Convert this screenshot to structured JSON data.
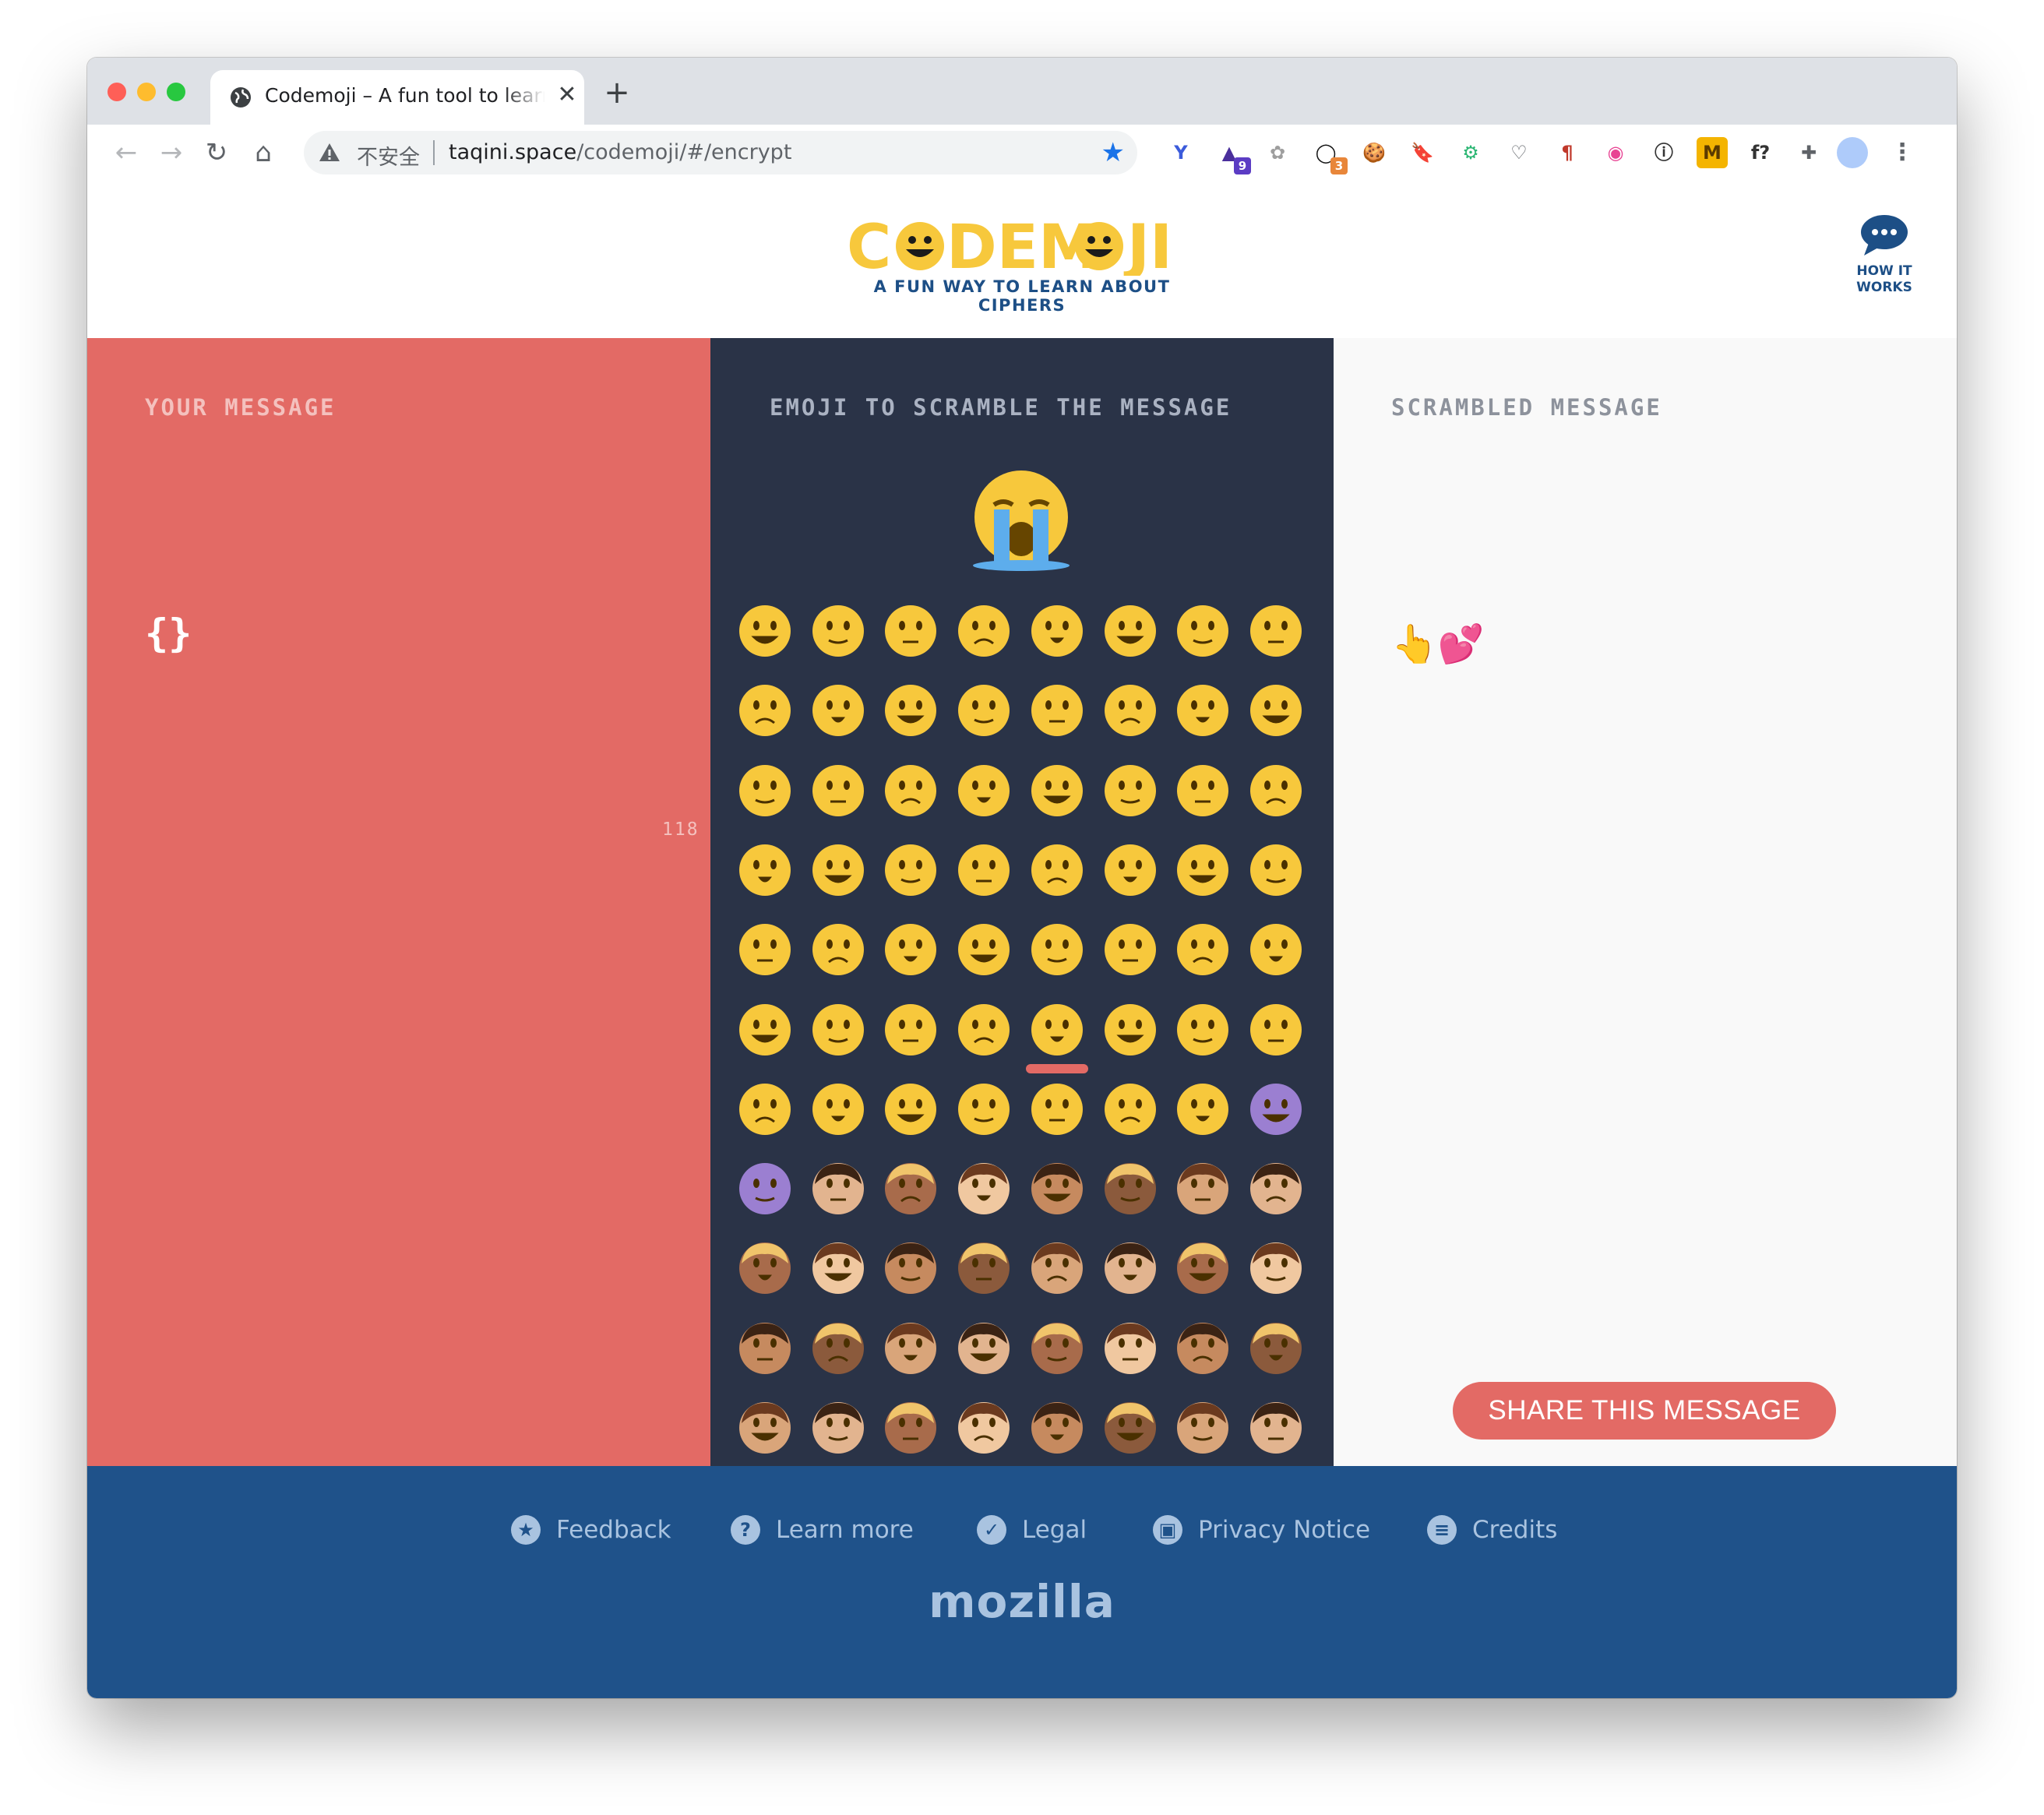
{
  "browser": {
    "tab_title": "Codemoji – A fun tool to learn about ciphers",
    "new_tab_label": "+",
    "close_tab_label": "✕",
    "security_label": "不安全",
    "url_host": "taqini.space",
    "url_path": "/codemoji/#/encrypt",
    "extensions": [
      {
        "name": "ext-y",
        "glyph": "Y",
        "badge": ""
      },
      {
        "name": "ext-graduation",
        "glyph": "▲",
        "badge": "9"
      },
      {
        "name": "ext-flower",
        "glyph": "✿",
        "badge": ""
      },
      {
        "name": "ext-ring",
        "glyph": "◯",
        "badge": "3"
      },
      {
        "name": "ext-cookie",
        "glyph": "🍪",
        "badge": ""
      },
      {
        "name": "ext-bookmark",
        "glyph": "🔖",
        "badge": ""
      },
      {
        "name": "ext-gear",
        "glyph": "⚙",
        "badge": ""
      },
      {
        "name": "ext-pocket",
        "glyph": "♡",
        "badge": ""
      },
      {
        "name": "ext-pilcrow",
        "glyph": "¶",
        "badge": ""
      },
      {
        "name": "ext-colorpicker",
        "glyph": "◉",
        "badge": ""
      },
      {
        "name": "ext-info",
        "glyph": "ⓘ",
        "badge": ""
      },
      {
        "name": "ext-m",
        "glyph": "M",
        "badge": ""
      },
      {
        "name": "ext-fontfinder",
        "glyph": "f?",
        "badge": ""
      },
      {
        "name": "ext-puzzle",
        "glyph": "✚",
        "badge": ""
      }
    ]
  },
  "header": {
    "logo_text": "CODEMOJI",
    "tagline": "A FUN WAY TO LEARN ABOUT CIPHERS",
    "how_it_works_line1": "HOW IT",
    "how_it_works_line2": "WORKS"
  },
  "left": {
    "title": "YOUR MESSAGE",
    "message": "{}",
    "char_count": "118"
  },
  "middle": {
    "title": "EMOJI TO SCRAMBLE THE MESSAGE",
    "selected_emoji": "😭",
    "selected_index": 44,
    "emojis": [
      "😀",
      "😁",
      "😂",
      "😃",
      "😄",
      "😅",
      "😆",
      "😉",
      "😊",
      "😋",
      "😎",
      "😍",
      "😘",
      "😗",
      "😙",
      "😚",
      "☺",
      "😇",
      "😐",
      "😑",
      "😶",
      "😏",
      "😣",
      "😥",
      "😮",
      "😯",
      "😪",
      "😫",
      "😴",
      "😌",
      "😛",
      "😜",
      "😝",
      "😒",
      "😓",
      "😔",
      "😕",
      "😖",
      "😷",
      "😲",
      "😞",
      "😟",
      "😤",
      "😢",
      "😭",
      "😦",
      "😧",
      "😨",
      "😩",
      "😬",
      "😰",
      "😱",
      "😳",
      "😵",
      "😠",
      "👿",
      "👿",
      "👦",
      "👧",
      "👨",
      "👩",
      "👴",
      "👵",
      "👶",
      "👱",
      "👮",
      "👲",
      "👳",
      "👷",
      "👸",
      "💂",
      "🎅",
      "👼",
      "👯",
      "💁",
      "💇",
      "👰",
      "🙍",
      "🙅",
      "🙆",
      "💁",
      "🙋",
      "🙇",
      "🙌",
      "🚶",
      "🏃",
      "💃",
      "💏"
    ]
  },
  "right": {
    "title": "SCRAMBLED MESSAGE",
    "scrambled": "👆💕",
    "share_label": "SHARE THIS MESSAGE"
  },
  "footer": {
    "links": [
      "Feedback",
      "Learn more",
      "Legal",
      "Privacy Notice",
      "Credits"
    ],
    "brand": "mozilla"
  },
  "colors": {
    "left_bg": "#e36a65",
    "middle_bg": "#2a3347",
    "right_bg": "#f9f9f9",
    "footer_bg": "#1f528a",
    "logo_yellow": "#f7c83c",
    "brand_blue": "#1d4f86"
  }
}
